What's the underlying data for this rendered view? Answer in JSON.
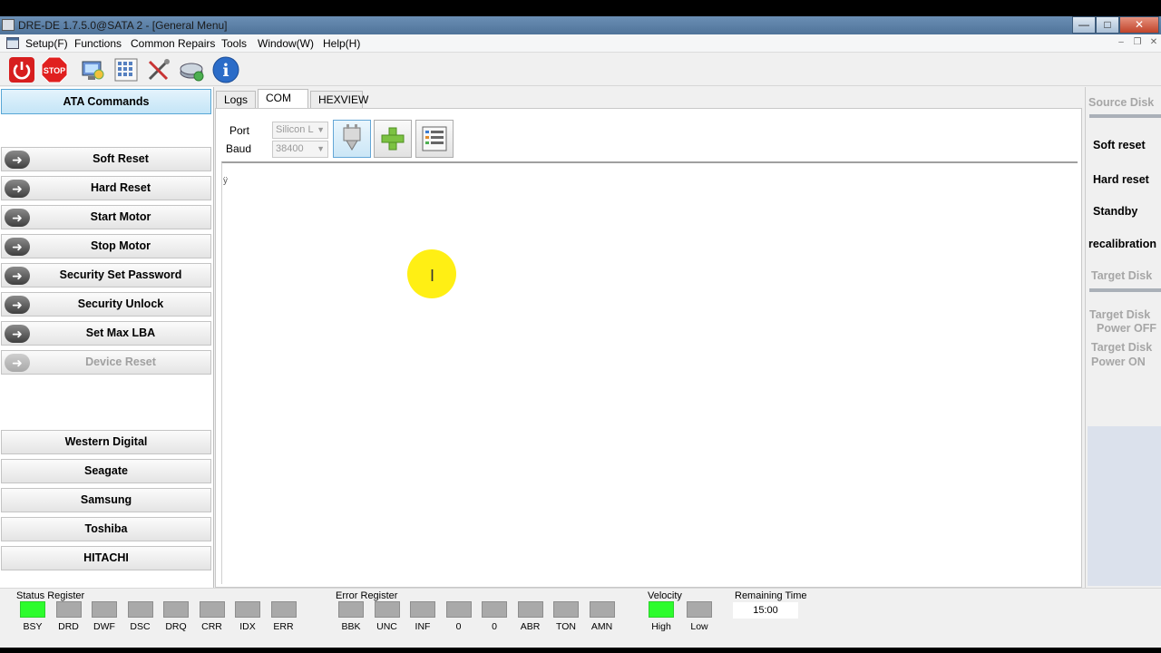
{
  "window": {
    "title": "DRE-DE 1.7.5.0@SATA 2 - [General Menu]",
    "controls": [
      "—",
      "□",
      "✕"
    ]
  },
  "menu": [
    "Setup(F)",
    "Functions",
    "Common Repairs",
    "Tools",
    "Window(W)",
    "Help(H)"
  ],
  "toolbar": {
    "stop_label": "STOP",
    "info_label": "i"
  },
  "left_panel": {
    "header": "ATA Commands",
    "ata_commands": [
      "Soft Reset",
      "Hard Reset",
      "Start Motor",
      "Stop Motor",
      "Security Set Password",
      "Security Unlock",
      "Set Max LBA",
      "Device Reset"
    ],
    "vendors": [
      "Western Digital",
      "Seagate",
      "Samsung",
      "Toshiba",
      "HITACHI"
    ]
  },
  "tabs": [
    "Logs",
    "COM",
    "HEXVIEW"
  ],
  "com": {
    "port_label": "Port",
    "baud_label": "Baud",
    "port_value": "Silicon L",
    "baud_value": "38400",
    "text_content": "ÿ"
  },
  "right_panel": {
    "source_disk": "Source Disk",
    "soft_reset": "Soft reset",
    "hard_reset": "Hard reset",
    "standby": "Standby",
    "recalibration": "recalibration",
    "target_disk": "Target Disk",
    "power_off": [
      "Target Disk",
      "Power OFF"
    ],
    "power_on": [
      "Target Disk",
      "Power ON"
    ]
  },
  "status": {
    "status_register_label": "Status Register",
    "status_bits": [
      {
        "name": "BSY",
        "on": true
      },
      {
        "name": "DRD",
        "on": false
      },
      {
        "name": "DWF",
        "on": false
      },
      {
        "name": "DSC",
        "on": false
      },
      {
        "name": "DRQ",
        "on": false
      },
      {
        "name": "CRR",
        "on": false
      },
      {
        "name": "IDX",
        "on": false
      },
      {
        "name": "ERR",
        "on": false
      }
    ],
    "error_register_label": "Error Register",
    "error_bits": [
      {
        "name": "BBK",
        "on": false
      },
      {
        "name": "UNC",
        "on": false
      },
      {
        "name": "INF",
        "on": false
      },
      {
        "name": "0",
        "on": false
      },
      {
        "name": "0",
        "on": false
      },
      {
        "name": "ABR",
        "on": false
      },
      {
        "name": "TON",
        "on": false
      },
      {
        "name": "AMN",
        "on": false
      }
    ],
    "velocity_label": "Velocity",
    "velocity_bits": [
      {
        "name": "High",
        "on": true
      },
      {
        "name": "Low",
        "on": false
      }
    ],
    "remaining_label": "Remaining Time",
    "remaining_value": "15:00"
  },
  "colors": {
    "led_on": "#2dfc2d",
    "led_off": "#a9a9a9",
    "selected_button": "#c4e5f7"
  }
}
